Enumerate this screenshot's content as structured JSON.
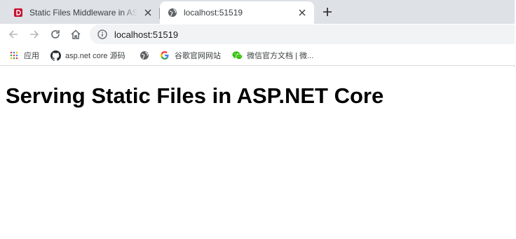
{
  "tabs": [
    {
      "title": "Static Files Middleware in ASP",
      "favicon": "red-square-d-icon",
      "active": false
    },
    {
      "title": "localhost:51519",
      "favicon": "globe-icon",
      "active": true
    }
  ],
  "toolbar": {
    "url": "localhost:51519"
  },
  "bookmarks": [
    {
      "label": "应用",
      "icon": "apps-grid-icon"
    },
    {
      "label": "asp.net core 源码",
      "icon": "github-icon"
    },
    {
      "label": "",
      "icon": "globe-icon"
    },
    {
      "label": "谷歌官网网站",
      "icon": "google-icon"
    },
    {
      "label": "微信官方文档 | 微...",
      "icon": "wechat-icon"
    }
  ],
  "page": {
    "heading": "Serving Static Files in ASP.NET Core"
  },
  "colors": {
    "tabstrip": "#dee1e6",
    "omnibox": "#f1f3f4",
    "favicon_red": "#c8102e"
  }
}
